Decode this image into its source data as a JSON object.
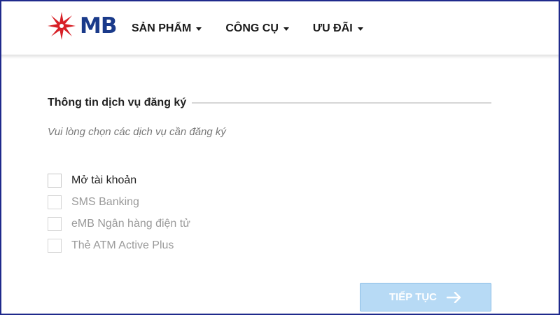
{
  "brand": {
    "name": "MB",
    "logo_icon": "mb-star-logo-icon",
    "accent": "#1a3a8a",
    "star_color": "#d71f26"
  },
  "nav": [
    {
      "label": "SẢN PHẨM"
    },
    {
      "label": "CÔNG CỤ"
    },
    {
      "label": "ƯU ĐÃI"
    }
  ],
  "section": {
    "title": "Thông tin dịch vụ đăng ký",
    "subtitle": "Vui lòng chọn các dịch vụ cần đăng ký"
  },
  "options": [
    {
      "label": "Mở tài khoản",
      "checked": false,
      "enabled": true
    },
    {
      "label": "SMS Banking",
      "checked": false,
      "enabled": false
    },
    {
      "label": "eMB Ngân hàng điện tử",
      "checked": false,
      "enabled": false
    },
    {
      "label": "Thẻ ATM Active Plus",
      "checked": false,
      "enabled": false
    }
  ],
  "continue_button": {
    "label": "TIẾP TỤC",
    "icon": "arrow-right-icon",
    "color": "#b7daf5"
  }
}
